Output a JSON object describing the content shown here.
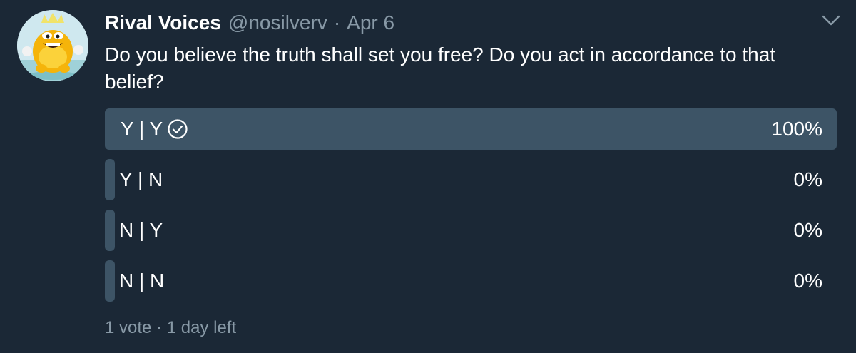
{
  "tweet": {
    "display_name": "Rival Voices",
    "handle": "@nosilverv",
    "separator": "·",
    "timestamp": "Apr 6",
    "text": "Do you believe the truth shall set you free? Do you act in accordance to that belief?",
    "menu_icon": "chevron-down-icon",
    "avatar_icon": "avatar"
  },
  "poll": {
    "options": [
      {
        "label": "Y | Y",
        "percent_label": "100%",
        "percent": 100,
        "selected": true
      },
      {
        "label": "Y | N",
        "percent_label": "0%",
        "percent": 0,
        "selected": false
      },
      {
        "label": "N | Y",
        "percent_label": "0%",
        "percent": 0,
        "selected": false
      },
      {
        "label": "N | N",
        "percent_label": "0%",
        "percent": 0,
        "selected": false
      }
    ],
    "votes": "1 vote",
    "footer_separator": "·",
    "time_left": "1 day left",
    "selected_icon": "check-circle-icon"
  },
  "colors": {
    "background": "#1b2836",
    "bar": "#3d5466",
    "secondary_text": "#8899a6",
    "primary_text": "#ffffff"
  }
}
